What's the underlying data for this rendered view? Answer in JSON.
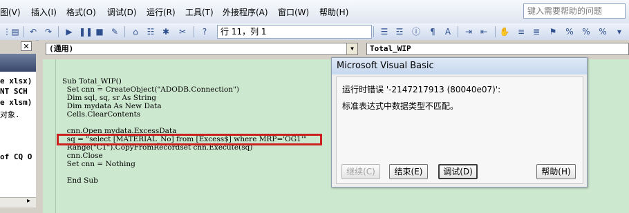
{
  "menubar": {
    "items": [
      "图(V)",
      "插入(I)",
      "格式(O)",
      "调试(D)",
      "运行(R)",
      "工具(T)",
      "外接程序(A)",
      "窗口(W)",
      "帮助(H)"
    ],
    "help_search_placeholder": "键入需要帮助的问题"
  },
  "toolbar": {
    "position_label": "行 11，列 1"
  },
  "left_pane": {
    "close_glyph": "✕",
    "lines": [
      "e xlsx)",
      "NT SCH",
      "e xlsm)",
      "对象.",
      "of CQ O"
    ]
  },
  "code_window": {
    "object_combo": "(通用)",
    "proc_combo": "Total_WIP",
    "lines": [
      "Sub Total_WIP()",
      "  Set cnn = CreateObject(\"ADODB.Connection\")",
      "  Dim sql, sq, sr As String",
      "  Dim mydata As New Data",
      "  Cells.ClearContents",
      "",
      "  cnn.Open mydata.ExcessData",
      "  sq = \"select [MATERIAL_No] from [Excess$] where MRP='OG1'\"",
      "  Range(\"C1\").CopyFromRecordset cnn.Execute(sq)",
      "  cnn.Close",
      "  Set cnn = Nothing",
      "",
      "  End Sub"
    ]
  },
  "dialog": {
    "title": "Microsoft Visual Basic",
    "error_line": "运行时错误 '-2147217913 (80040e07)':",
    "message": "标准表达式中数据类型不匹配。",
    "buttons": {
      "continue": "继续(C)",
      "end": "结束(E)",
      "debug": "调试(D)",
      "help": "帮助(H)"
    }
  },
  "colors": {
    "code_background": "#cce8cf",
    "highlight_border": "#cc1f1f"
  }
}
